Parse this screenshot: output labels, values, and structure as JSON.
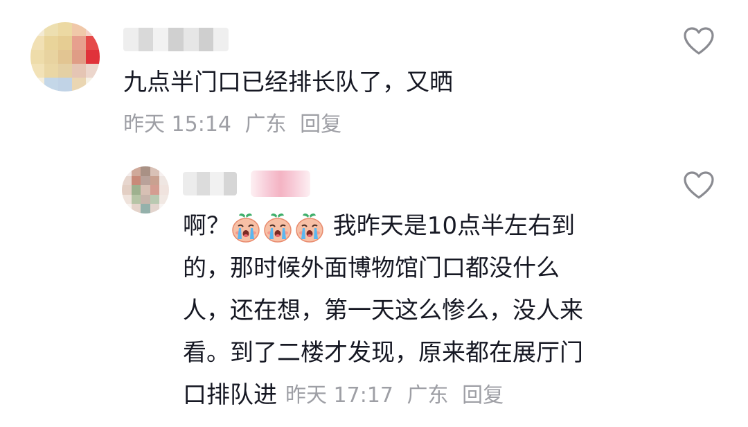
{
  "comment": {
    "text": "九点半门口已经排长队了，又晒",
    "time": "昨天 15:14",
    "location": "广东",
    "reply_label": "回复",
    "avatar_colors": [
      "#f3ead3",
      "#eddfb0",
      "#ecd9a3",
      "#f0c8a9",
      "#f5d0c6",
      "#f1e0b4",
      "#e9d49a",
      "#e6cd93",
      "#e7a08e",
      "#e54a49",
      "#eedcaa",
      "#e8d3a0",
      "#e2c592",
      "#df9d86",
      "#e0323a",
      "#f2e2b7",
      "#ead7a5",
      "#e4d0a4",
      "#e5c5b4",
      "#ecd6cc",
      "#f5eedc",
      "#c4d7e8",
      "#c1d3e6",
      "#ead6b2",
      "#f6f1e5"
    ],
    "username_blur_colors": [
      "#eeeeee",
      "#d9d9d9",
      "#f2f2f2",
      "#d0d0d0",
      "#e6e6e6",
      "#cfcfcf",
      "#efefef"
    ]
  },
  "reply": {
    "lines": [
      {
        "before": "啊？",
        "emojis": 3,
        "after": " 我昨天是10点半左右到"
      },
      {
        "before": "的，那时候外面博物馆门口都没什么"
      },
      {
        "before": "人，还在想，第一天这么惨么，没人来"
      },
      {
        "before": "看。到了二楼才发现，原来都在展厅门"
      }
    ],
    "last_line": "口排队进",
    "time": "昨天 17:17",
    "location": "广东",
    "reply_label": "回复",
    "emoji_name": "crying-emoji",
    "avatar_colors": [
      "#f3eceb",
      "#cfa99a",
      "#a99185",
      "#d9c1b6",
      "#f6f0ef",
      "#e7d6ce",
      "#c88a79",
      "#b9a29a",
      "#c9a190",
      "#efe6e2",
      "#e3cfc4",
      "#9eb18f",
      "#d7c0b4",
      "#d49d91",
      "#f0e3de",
      "#efe3dc",
      "#b6c4a6",
      "#c7b5ab",
      "#b9c9b1",
      "#f1e8e3",
      "#f7f2ef",
      "#e4d3ca",
      "#94b1ab",
      "#e2d4cd",
      "#f8f4f2"
    ],
    "username_blur_colors": [
      "#ececec",
      "#dcdcdc",
      "#f1f1f1",
      "#d6d6d6"
    ]
  },
  "colors": {
    "text": "#161823",
    "meta": "#9e9fa5",
    "heart_stroke": "#8a8b91"
  },
  "icons": {
    "like": "heart-outline-icon"
  }
}
